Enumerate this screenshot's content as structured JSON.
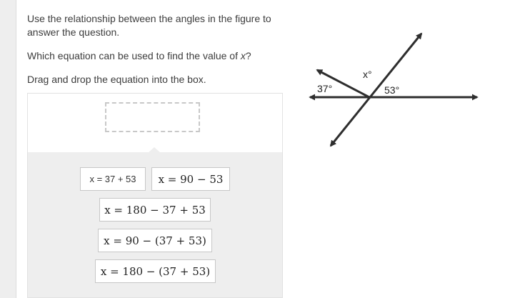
{
  "question": {
    "instruction": "Use the relationship between the angles in the figure to answer the question.",
    "prompt_before": "Which equation can be used to find the value of ",
    "prompt_var": "x",
    "prompt_after": "?",
    "directions": "Drag and drop the equation into the box."
  },
  "figure": {
    "label_x": "x°",
    "label_37": "37°",
    "label_53": "53°"
  },
  "tiles": [
    "x = 37 + 53",
    "x = 90 − 53",
    "x = 180 − 37 + 53",
    "x = 90 − (37 + 53)",
    "x = 180 − (37 + 53)"
  ],
  "colors": {
    "line": "#2e2e2e",
    "tray": "#eeeeee"
  }
}
